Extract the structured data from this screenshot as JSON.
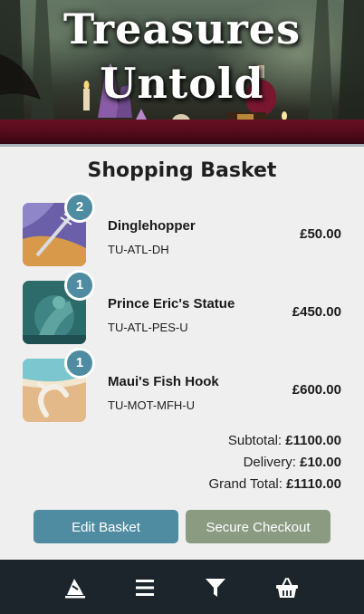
{
  "hero": {
    "title_line1": "Treasures",
    "title_line2": "Untold"
  },
  "basket": {
    "heading": "Shopping Basket",
    "items": [
      {
        "quantity": "2",
        "name": "Dinglehopper",
        "sku": "TU-ATL-DH",
        "price": "£50.00"
      },
      {
        "quantity": "1",
        "name": "Prince Eric's Statue",
        "sku": "TU-ATL-PES-U",
        "price": "£450.00"
      },
      {
        "quantity": "1",
        "name": "Maui's Fish Hook",
        "sku": "TU-MOT-MFH-U",
        "price": "£600.00"
      }
    ],
    "subtotal_label": "Subtotal: ",
    "subtotal_value": "£1100.00",
    "delivery_label": "Delivery: ",
    "delivery_value": "£10.00",
    "grand_total_label": "Grand Total: ",
    "grand_total_value": "£1110.00"
  },
  "actions": {
    "edit_label": "Edit Basket",
    "checkout_label": "Secure Checkout"
  },
  "nav": {
    "icons": [
      "wizard-hat-icon",
      "menu-icon",
      "filter-icon",
      "basket-icon"
    ]
  },
  "colors": {
    "accent_teal": "#4f8ca1",
    "checkout_green": "#8a9b82",
    "nav_background": "#1b252b"
  }
}
